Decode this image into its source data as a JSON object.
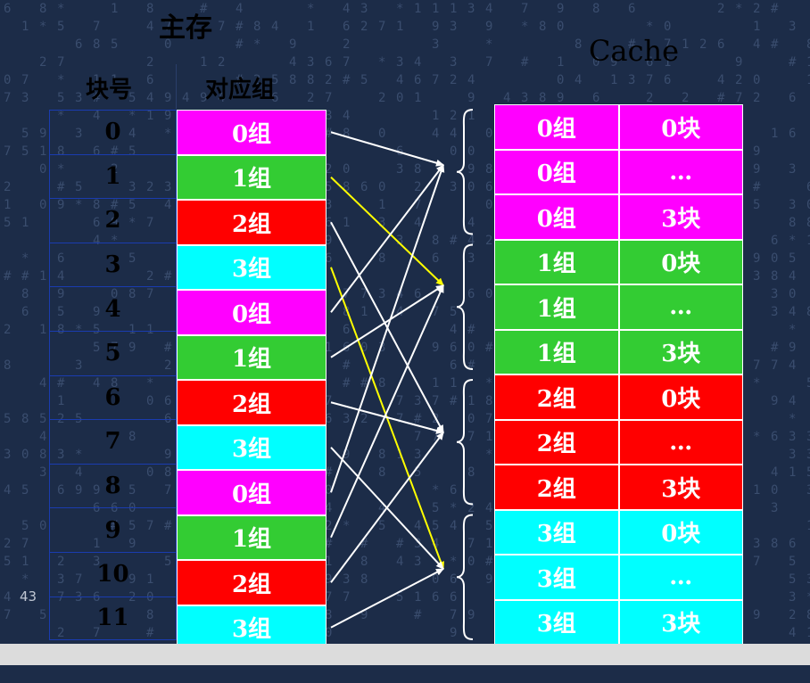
{
  "main_memory_title": "主存",
  "cache_title": "Cache",
  "headers": {
    "block_no": "块号",
    "group": "对应组"
  },
  "blocks": [
    {
      "no": "0",
      "group": "0组",
      "color": "#ff00ff"
    },
    {
      "no": "1",
      "group": "1组",
      "color": "#33cc33"
    },
    {
      "no": "2",
      "group": "2组",
      "color": "#ff0000"
    },
    {
      "no": "3",
      "group": "3组",
      "color": "#00ffff"
    },
    {
      "no": "4",
      "group": "0组",
      "color": "#ff00ff"
    },
    {
      "no": "5",
      "group": "1组",
      "color": "#33cc33"
    },
    {
      "no": "6",
      "group": "2组",
      "color": "#ff0000"
    },
    {
      "no": "7",
      "group": "3组",
      "color": "#00ffff"
    },
    {
      "no": "8",
      "group": "0组",
      "color": "#ff00ff"
    },
    {
      "no": "9",
      "group": "1组",
      "color": "#33cc33"
    },
    {
      "no": "10",
      "group": "2组",
      "color": "#ff0000"
    },
    {
      "no": "11",
      "group": "3组",
      "color": "#00ffff"
    }
  ],
  "cache_rows": [
    {
      "group": "0组",
      "block": "0块",
      "color": "#ff00ff"
    },
    {
      "group": "0组",
      "block": "…",
      "color": "#ff00ff"
    },
    {
      "group": "0组",
      "block": "3块",
      "color": "#ff00ff"
    },
    {
      "group": "1组",
      "block": "0块",
      "color": "#33cc33"
    },
    {
      "group": "1组",
      "block": "…",
      "color": "#33cc33"
    },
    {
      "group": "1组",
      "block": "3块",
      "color": "#33cc33"
    },
    {
      "group": "2组",
      "block": "0块",
      "color": "#ff0000"
    },
    {
      "group": "2组",
      "block": "…",
      "color": "#ff0000"
    },
    {
      "group": "2组",
      "block": "3块",
      "color": "#ff0000"
    },
    {
      "group": "3组",
      "block": "0块",
      "color": "#00ffff"
    },
    {
      "group": "3组",
      "block": "…",
      "color": "#00ffff"
    },
    {
      "group": "3组",
      "block": "3块",
      "color": "#00ffff"
    }
  ],
  "mapping": {
    "block_to_group": [
      0,
      1,
      2,
      3,
      0,
      1,
      2,
      3,
      0,
      1,
      2,
      3
    ],
    "highlighted_blocks": [
      1,
      3
    ],
    "highlight_color": "#ffff00",
    "arrow_color": "#ffffff"
  },
  "page_number": "43"
}
